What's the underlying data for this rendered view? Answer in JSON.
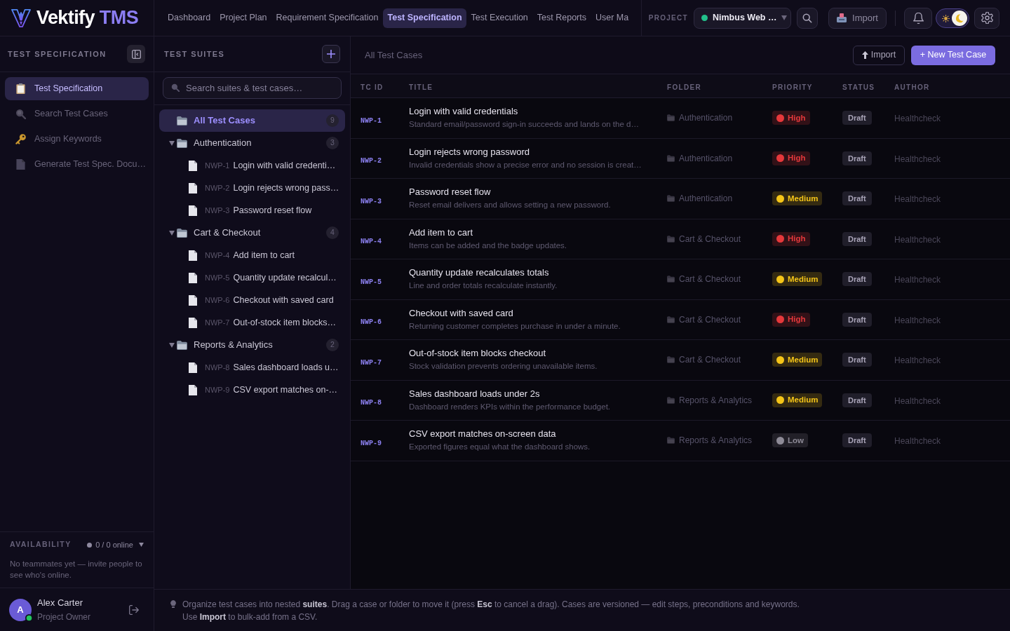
{
  "logo": {
    "name": "Vektify",
    "suffix": "TMS"
  },
  "nav_tabs": [
    {
      "label": "Dashboard",
      "selected": false
    },
    {
      "label": "Project Plan",
      "selected": false
    },
    {
      "label": "Requirement Specification",
      "selected": false
    },
    {
      "label": "Test Specification",
      "selected": true
    },
    {
      "label": "Test Execution",
      "selected": false
    },
    {
      "label": "Test Reports",
      "selected": false
    },
    {
      "label": "User Ma",
      "selected": false
    }
  ],
  "project": {
    "label": "PROJECT",
    "name": "Nimbus Web …",
    "active": true
  },
  "header_actions": {
    "import_label": "Import",
    "theme_toggle": {
      "on": true
    }
  },
  "sidebar": {
    "title": "TEST SPECIFICATION",
    "items": [
      {
        "label": "Test Specification",
        "selected": true
      },
      {
        "label": "Search Test Cases",
        "selected": false
      },
      {
        "label": "Assign Keywords",
        "selected": false
      },
      {
        "label": "Generate Test Spec. Docu…",
        "selected": false
      }
    ]
  },
  "availability": {
    "title": "AVAILABILITY",
    "status": "0 / 0 online",
    "message": "No teammates yet — invite people to see who's online."
  },
  "user": {
    "initial": "A",
    "name": "Alex Carter",
    "role": "Project Owner",
    "online": true
  },
  "suites": {
    "title": "TEST SUITES",
    "search": {
      "placeholder": "Search suites & test cases…"
    },
    "tree": [
      {
        "kind": "all",
        "label": "All Test Cases",
        "count": "9",
        "selected": true
      },
      {
        "kind": "folder",
        "label": "Authentication",
        "count": "3",
        "expanded": true,
        "selected": false,
        "children": [
          {
            "kind": "case",
            "id": "NWP-1",
            "title": "Login with valid credenti…",
            "selected": false
          },
          {
            "kind": "case",
            "id": "NWP-2",
            "title": "Login rejects wrong pass…",
            "selected": false
          },
          {
            "kind": "case",
            "id": "NWP-3",
            "title": "Password reset flow",
            "selected": false
          }
        ]
      },
      {
        "kind": "folder",
        "label": "Cart & Checkout",
        "count": "4",
        "expanded": true,
        "selected": false,
        "children": [
          {
            "kind": "case",
            "id": "NWP-4",
            "title": "Add item to cart",
            "selected": false
          },
          {
            "kind": "case",
            "id": "NWP-5",
            "title": "Quantity update recalcul…",
            "selected": false
          },
          {
            "kind": "case",
            "id": "NWP-6",
            "title": "Checkout with saved card",
            "selected": false
          },
          {
            "kind": "case",
            "id": "NWP-7",
            "title": "Out-of-stock item blocks…",
            "selected": false
          }
        ]
      },
      {
        "kind": "folder",
        "label": "Reports & Analytics",
        "count": "2",
        "expanded": true,
        "selected": false,
        "children": [
          {
            "kind": "case",
            "id": "NWP-8",
            "title": "Sales dashboard loads u…",
            "selected": false
          },
          {
            "kind": "case",
            "id": "NWP-9",
            "title": "CSV export matches on-…",
            "selected": false
          }
        ]
      }
    ]
  },
  "main": {
    "breadcrumb": "All Test Cases",
    "import_label": "Import",
    "new_label": "+ New Test Case"
  },
  "table": {
    "columns": [
      "TC ID",
      "TITLE",
      "FOLDER",
      "PRIORITY",
      "STATUS",
      "AUTHOR"
    ],
    "rows": [
      {
        "id": "NWP-1",
        "title": "Login with valid credentials",
        "description": "Standard email/password sign-in succeeds and lands on the d…",
        "folder": "Authentication",
        "priority": {
          "label": "High",
          "color": "#e5383b"
        },
        "status": "Draft",
        "author": "Healthcheck"
      },
      {
        "id": "NWP-2",
        "title": "Login rejects wrong password",
        "description": "Invalid credentials show a precise error and no session is creat…",
        "folder": "Authentication",
        "priority": {
          "label": "High",
          "color": "#e5383b"
        },
        "status": "Draft",
        "author": "Healthcheck"
      },
      {
        "id": "NWP-3",
        "title": "Password reset flow",
        "description": "Reset email delivers and allows setting a new password.",
        "folder": "Authentication",
        "priority": {
          "label": "Medium",
          "color": "#f5c518"
        },
        "status": "Draft",
        "author": "Healthcheck"
      },
      {
        "id": "NWP-4",
        "title": "Add item to cart",
        "description": "Items can be added and the badge updates.",
        "folder": "Cart & Checkout",
        "priority": {
          "label": "High",
          "color": "#e5383b"
        },
        "status": "Draft",
        "author": "Healthcheck"
      },
      {
        "id": "NWP-5",
        "title": "Quantity update recalculates totals",
        "description": "Line and order totals recalculate instantly.",
        "folder": "Cart & Checkout",
        "priority": {
          "label": "Medium",
          "color": "#f5c518"
        },
        "status": "Draft",
        "author": "Healthcheck"
      },
      {
        "id": "NWP-6",
        "title": "Checkout with saved card",
        "description": "Returning customer completes purchase in under a minute.",
        "folder": "Cart & Checkout",
        "priority": {
          "label": "High",
          "color": "#e5383b"
        },
        "status": "Draft",
        "author": "Healthcheck"
      },
      {
        "id": "NWP-7",
        "title": "Out-of-stock item blocks checkout",
        "description": "Stock validation prevents ordering unavailable items.",
        "folder": "Cart & Checkout",
        "priority": {
          "label": "Medium",
          "color": "#f5c518"
        },
        "status": "Draft",
        "author": "Healthcheck"
      },
      {
        "id": "NWP-8",
        "title": "Sales dashboard loads under 2s",
        "description": "Dashboard renders KPIs within the performance budget.",
        "folder": "Reports & Analytics",
        "priority": {
          "label": "Medium",
          "color": "#f5c518"
        },
        "status": "Draft",
        "author": "Healthcheck"
      },
      {
        "id": "NWP-9",
        "title": "CSV export matches on-screen data",
        "description": "Exported figures equal what the dashboard shows.",
        "folder": "Reports & Analytics",
        "priority": {
          "label": "Low",
          "color": "#8e8b97"
        },
        "status": "Draft",
        "author": "Healthcheck"
      }
    ]
  },
  "footer": {
    "tip": "Organize test cases into nested **suites**. Drag a case or folder to move it (press **Esc** to cancel a drag). Cases are versioned — edit steps, preconditions and keywords. Use **Import** to bulk-add from a CSV."
  }
}
